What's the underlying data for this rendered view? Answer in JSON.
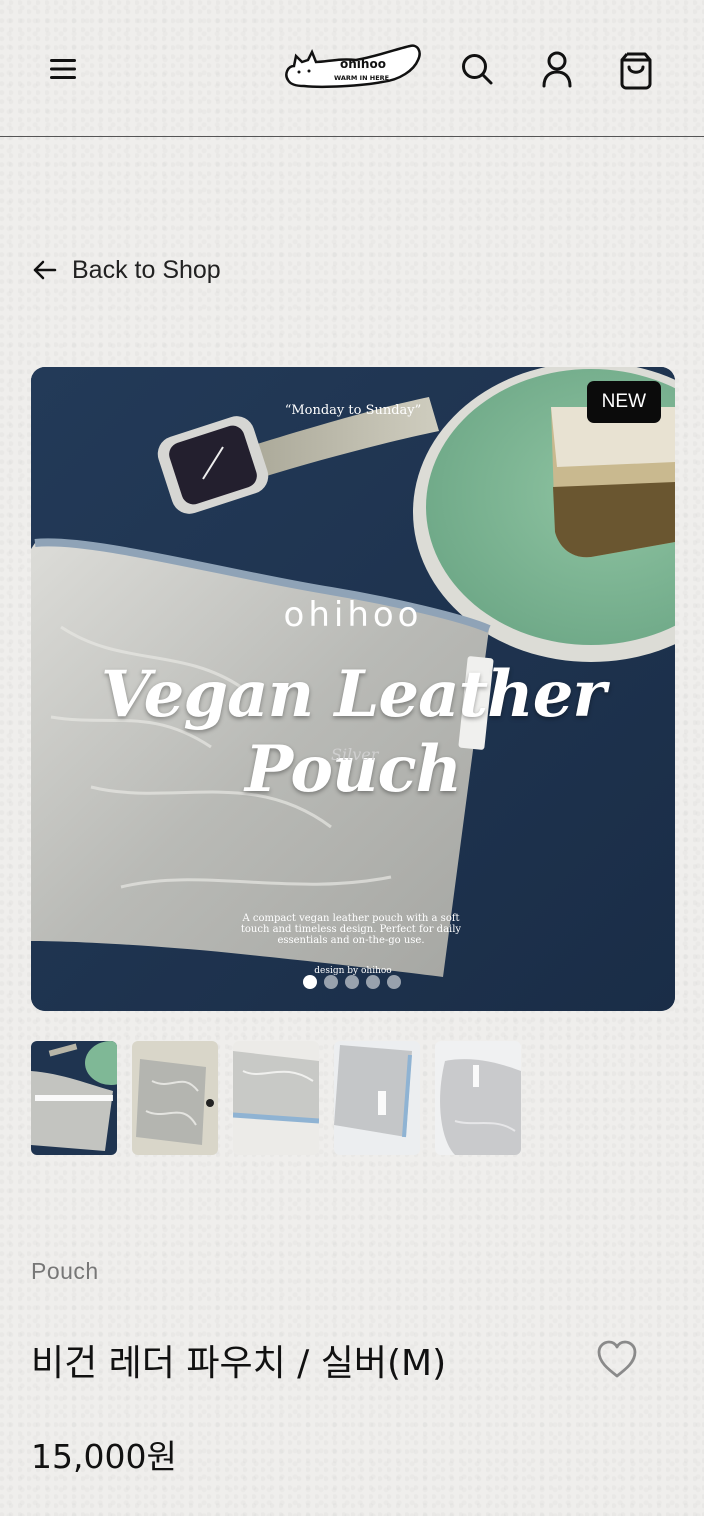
{
  "header": {
    "logo": {
      "brand": "ohihoo",
      "tagline": "WARM IN HERE"
    },
    "icons": {
      "menu": "hamburger-menu-icon",
      "search": "search-icon",
      "account": "user-icon",
      "cart": "shopping-bag-icon"
    }
  },
  "nav": {
    "back_label": "Back to Shop"
  },
  "product": {
    "badge": "NEW",
    "image_overlay": {
      "quote": "“Monday to Sunday”",
      "brand": "ohihoo",
      "title": "Vegan Leather Pouch",
      "variant": "Silver",
      "description": "A compact vegan leather pouch with a soft touch and timeless design. Perfect for daily essentials and on-the-go use.",
      "credit": "design by ohihoo"
    },
    "slide_count": 5,
    "active_slide": 1,
    "thumbnails": [
      "thumb-1",
      "thumb-2",
      "thumb-3",
      "thumb-4",
      "thumb-5"
    ],
    "category": "Pouch",
    "name": "비건 레더 파우치 / 실버(M)",
    "price": "15,000원"
  },
  "colors": {
    "badge_bg": "#0b0b0b",
    "hero_bg": "#1f3450",
    "page_bg": "#efeeec",
    "wish_icon": "#8a8a8a"
  }
}
